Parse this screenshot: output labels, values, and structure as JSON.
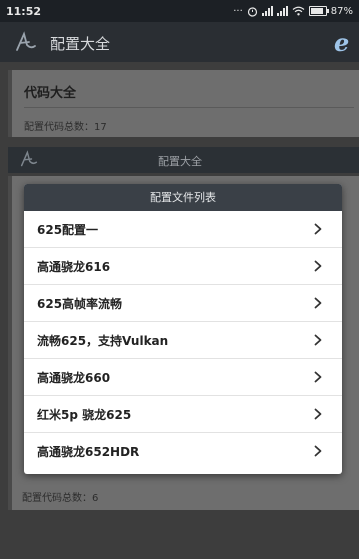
{
  "status_bar": {
    "time": "11:52",
    "icons_text": "···",
    "battery": "87%",
    "battery_level": 0.87
  },
  "app_bar": {
    "title": "配置大全",
    "logo_icon": "signature-logo-icon",
    "action_icon": "ie-browser-icon"
  },
  "background": {
    "card1": {
      "title": "代码大全",
      "count": "配置代码总数：17"
    },
    "section": {
      "title": "配置大全"
    },
    "card2": {
      "count": "配置代码总数：6"
    }
  },
  "dialog": {
    "title": "配置文件列表",
    "items": [
      {
        "label": "625配置一"
      },
      {
        "label": "高通骁龙616"
      },
      {
        "label": "625高帧率流畅"
      },
      {
        "label": "流畅625，支持Vulkan"
      },
      {
        "label": "高通骁龙660"
      },
      {
        "label": "红米5p 骁龙625"
      },
      {
        "label": "高通骁龙652HDR"
      }
    ]
  },
  "colors": {
    "status_bar": "#1c2025",
    "app_bar": "#2a2e33",
    "dialog_header": "#3a4047",
    "dialog_bg": "#ffffff"
  }
}
